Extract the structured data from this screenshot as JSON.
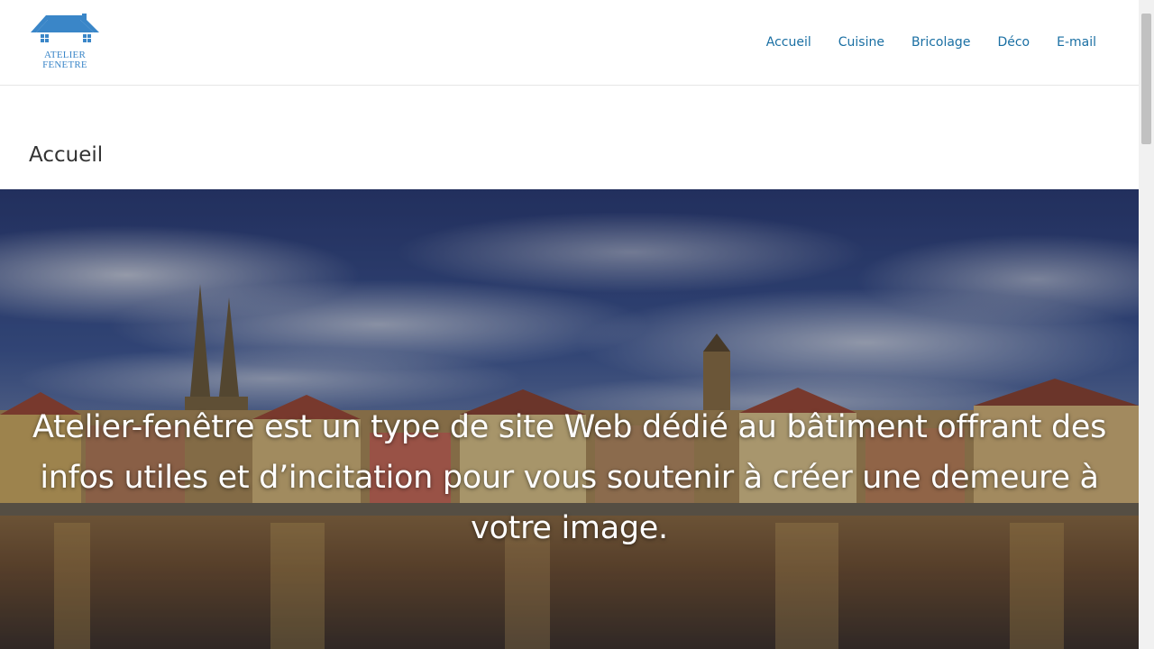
{
  "site": {
    "logo_line_1": "ATELIER",
    "logo_line_2": "FENETRE"
  },
  "nav": {
    "items": [
      {
        "label": "Accueil"
      },
      {
        "label": "Cuisine"
      },
      {
        "label": "Bricolage"
      },
      {
        "label": "Déco"
      },
      {
        "label": "E-mail"
      }
    ]
  },
  "page": {
    "title": "Accueil"
  },
  "hero": {
    "text": "Atelier-fenêtre est un type de site Web dédié au bâtiment offrant des infos utiles et d’incitation pour vous soutenir à créer une demeure à votre image."
  },
  "colors": {
    "accent": "#1a6fa3",
    "logo_blue": "#3a86c8",
    "title": "#333333"
  },
  "icons": {
    "logo": "house-roof-icon"
  }
}
